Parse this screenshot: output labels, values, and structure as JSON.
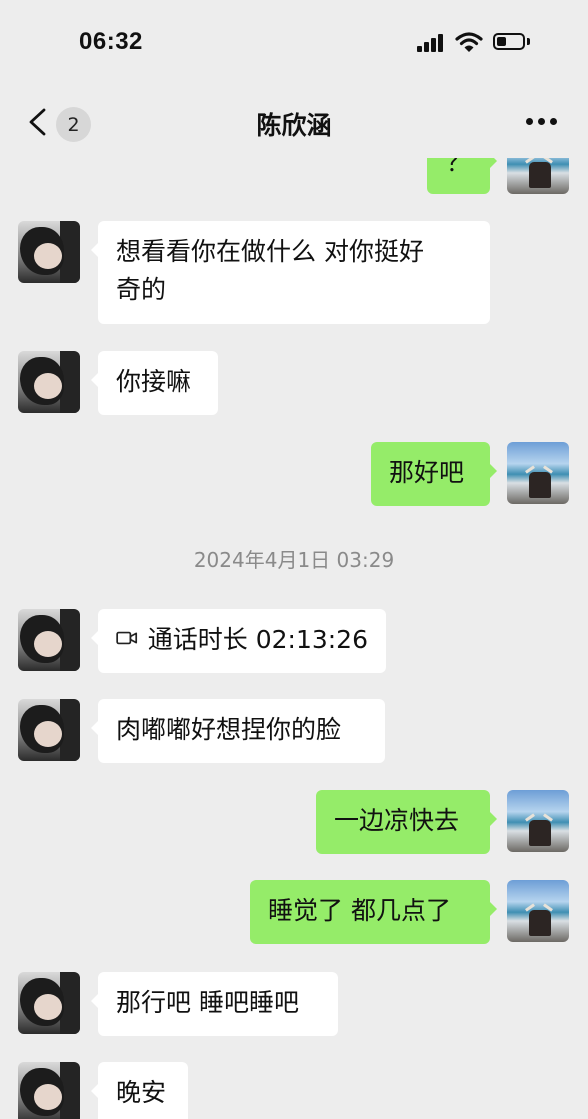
{
  "status_bar": {
    "time": "06:32",
    "icons": [
      "signal-icon",
      "wifi-icon",
      "battery-icon"
    ]
  },
  "header": {
    "back_icon": "chevron-left-icon",
    "unread_count": "2",
    "title": "陈欣涵",
    "more_icon": "more-dots-icon"
  },
  "colors": {
    "background": "#ededed",
    "incoming_bubble": "#ffffff",
    "outgoing_bubble": "#95ec69",
    "timestamp_text": "#8a8a8a"
  },
  "messages": [
    {
      "direction": "out",
      "text": "？"
    },
    {
      "direction": "in",
      "text_line1": "想看看你在做什么 对你挺好",
      "text_line2": "奇的"
    },
    {
      "direction": "in",
      "text": "你接嘛"
    },
    {
      "direction": "out",
      "text": "那好吧"
    },
    {
      "type": "timestamp",
      "text": "2024年4月1日 03:29"
    },
    {
      "direction": "in",
      "type": "video-call",
      "icon": "video-call-icon",
      "text": "通话时长 02:13:26"
    },
    {
      "direction": "in",
      "text": "肉嘟嘟好想捏你的脸"
    },
    {
      "direction": "out",
      "text": "一边凉快去"
    },
    {
      "direction": "out",
      "text": "睡觉了 都几点了"
    },
    {
      "direction": "in",
      "text": "那行吧 睡吧睡吧"
    },
    {
      "direction": "in",
      "text": "晚安"
    }
  ]
}
